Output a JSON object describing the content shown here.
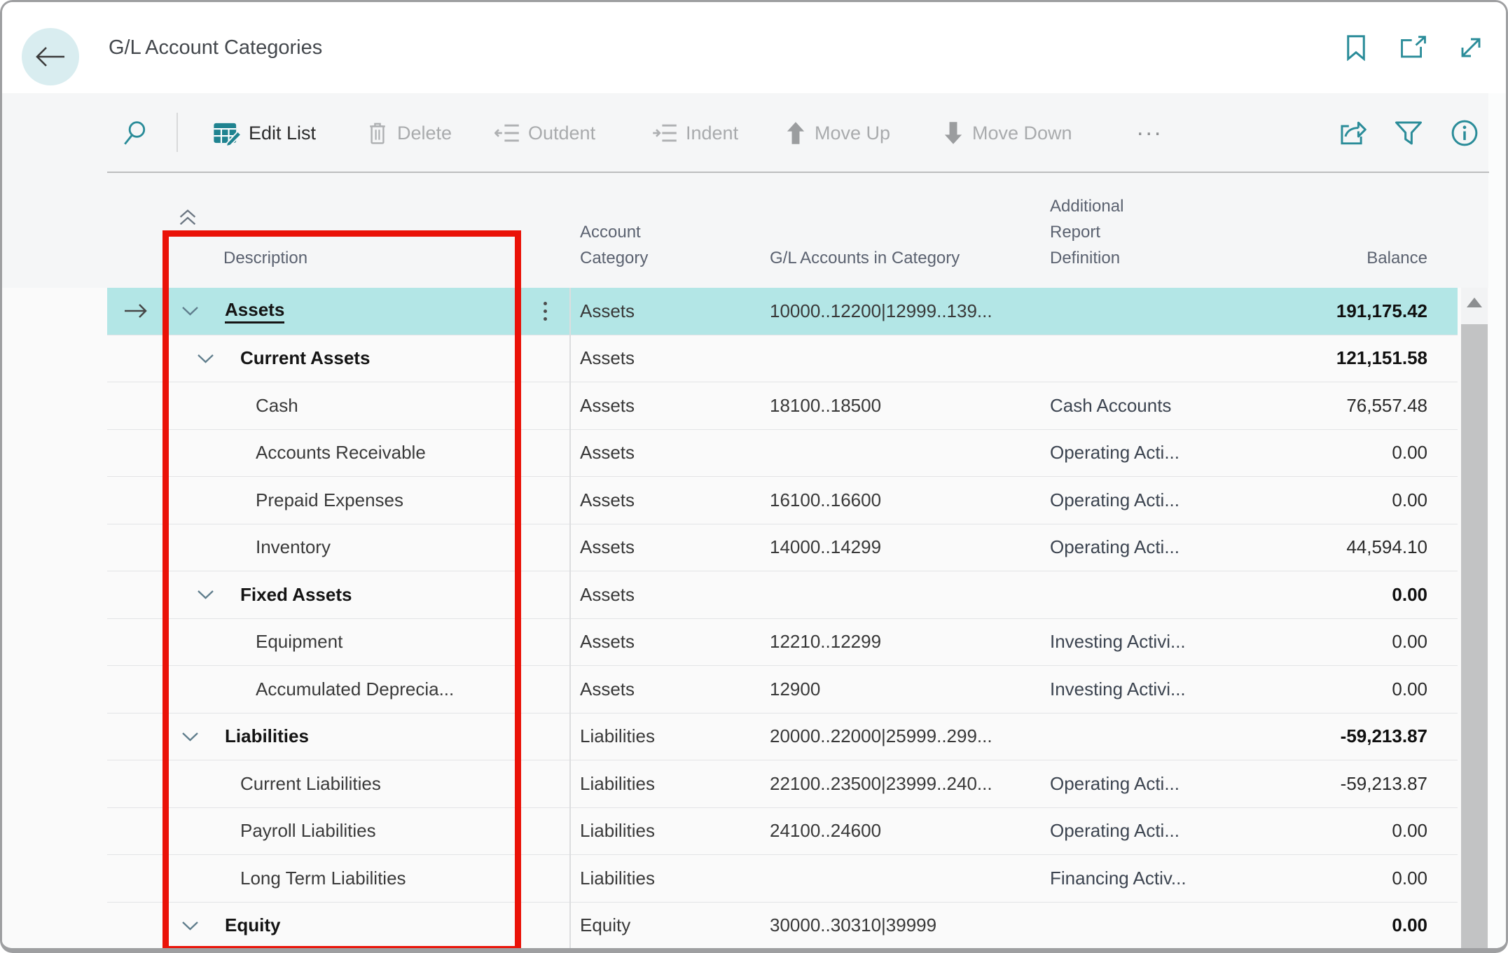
{
  "title_bar": {
    "title": "G/L Account Categories",
    "icons": [
      "bookmark-icon",
      "popout-icon",
      "expand-icon"
    ]
  },
  "toolbar": {
    "edit_list": "Edit List",
    "delete": "Delete",
    "outdent": "Outdent",
    "indent": "Indent",
    "move_up": "Move Up",
    "move_down": "Move Down",
    "more": "...",
    "right_icons": [
      "share-icon",
      "filter-icon",
      "info-icon"
    ],
    "left_icon": "search-icon"
  },
  "table": {
    "columns": {
      "description": "Description",
      "account_category": "Account\nCategory",
      "gl_accounts": "G/L Accounts in Category",
      "additional": "Additional\nReport\nDefinition",
      "balance": "Balance"
    },
    "rows": [
      {
        "description": "Assets",
        "level": 0,
        "bold": true,
        "chevron": true,
        "selected": true,
        "underline": true,
        "account_category": "Assets",
        "gl_accounts": "10000..12200|12999..139...",
        "additional": "",
        "balance": "191,175.42",
        "balance_bold": true
      },
      {
        "description": "Current Assets",
        "level": 1,
        "bold": true,
        "chevron": true,
        "selected": false,
        "underline": false,
        "account_category": "Assets",
        "gl_accounts": "",
        "additional": "",
        "balance": "121,151.58",
        "balance_bold": true
      },
      {
        "description": "Cash",
        "level": 2,
        "bold": false,
        "chevron": false,
        "selected": false,
        "underline": false,
        "account_category": "Assets",
        "gl_accounts": "18100..18500",
        "additional": "Cash Accounts",
        "balance": "76,557.48",
        "balance_bold": false
      },
      {
        "description": "Accounts Receivable",
        "level": 2,
        "bold": false,
        "chevron": false,
        "selected": false,
        "underline": false,
        "account_category": "Assets",
        "gl_accounts": "",
        "additional": "Operating Acti...",
        "balance": "0.00",
        "balance_bold": false
      },
      {
        "description": "Prepaid Expenses",
        "level": 2,
        "bold": false,
        "chevron": false,
        "selected": false,
        "underline": false,
        "account_category": "Assets",
        "gl_accounts": "16100..16600",
        "additional": "Operating Acti...",
        "balance": "0.00",
        "balance_bold": false
      },
      {
        "description": "Inventory",
        "level": 2,
        "bold": false,
        "chevron": false,
        "selected": false,
        "underline": false,
        "account_category": "Assets",
        "gl_accounts": "14000..14299",
        "additional": "Operating Acti...",
        "balance": "44,594.10",
        "balance_bold": false
      },
      {
        "description": "Fixed Assets",
        "level": 1,
        "bold": true,
        "chevron": true,
        "selected": false,
        "underline": false,
        "account_category": "Assets",
        "gl_accounts": "",
        "additional": "",
        "balance": "0.00",
        "balance_bold": true
      },
      {
        "description": "Equipment",
        "level": 2,
        "bold": false,
        "chevron": false,
        "selected": false,
        "underline": false,
        "account_category": "Assets",
        "gl_accounts": "12210..12299",
        "additional": "Investing Activi...",
        "balance": "0.00",
        "balance_bold": false
      },
      {
        "description": "Accumulated Deprecia...",
        "level": 2,
        "bold": false,
        "chevron": false,
        "selected": false,
        "underline": false,
        "account_category": "Assets",
        "gl_accounts": "12900",
        "additional": "Investing Activi...",
        "balance": "0.00",
        "balance_bold": false
      },
      {
        "description": "Liabilities",
        "level": 0,
        "bold": true,
        "chevron": true,
        "selected": false,
        "underline": false,
        "account_category": "Liabilities",
        "gl_accounts": "20000..22000|25999..299...",
        "additional": "",
        "balance": "-59,213.87",
        "balance_bold": true
      },
      {
        "description": "Current Liabilities",
        "level": 1,
        "bold": false,
        "chevron": false,
        "selected": false,
        "underline": false,
        "account_category": "Liabilities",
        "gl_accounts": "22100..23500|23999..240...",
        "additional": "Operating Acti...",
        "balance": "-59,213.87",
        "balance_bold": false
      },
      {
        "description": "Payroll Liabilities",
        "level": 1,
        "bold": false,
        "chevron": false,
        "selected": false,
        "underline": false,
        "account_category": "Liabilities",
        "gl_accounts": "24100..24600",
        "additional": "Operating Acti...",
        "balance": "0.00",
        "balance_bold": false
      },
      {
        "description": "Long Term Liabilities",
        "level": 1,
        "bold": false,
        "chevron": false,
        "selected": false,
        "underline": false,
        "account_category": "Liabilities",
        "gl_accounts": "",
        "additional": "Financing Activ...",
        "balance": "0.00",
        "balance_bold": false
      },
      {
        "description": "Equity",
        "level": 0,
        "bold": true,
        "chevron": true,
        "selected": false,
        "underline": false,
        "account_category": "Equity",
        "gl_accounts": "30000..30310|39999",
        "additional": "",
        "balance": "0.00",
        "balance_bold": true
      }
    ]
  },
  "annotation": {
    "shape": "rectangle",
    "color": "#ea1208",
    "highlights": "description-column"
  },
  "colors": {
    "accent": "#2a8c99",
    "selection": "#b3e6e6",
    "annotation_red": "#ea1208",
    "disabled_text": "#a9abad",
    "header_text": "#5b6270",
    "chrome_bg": "#f5f6f7"
  }
}
